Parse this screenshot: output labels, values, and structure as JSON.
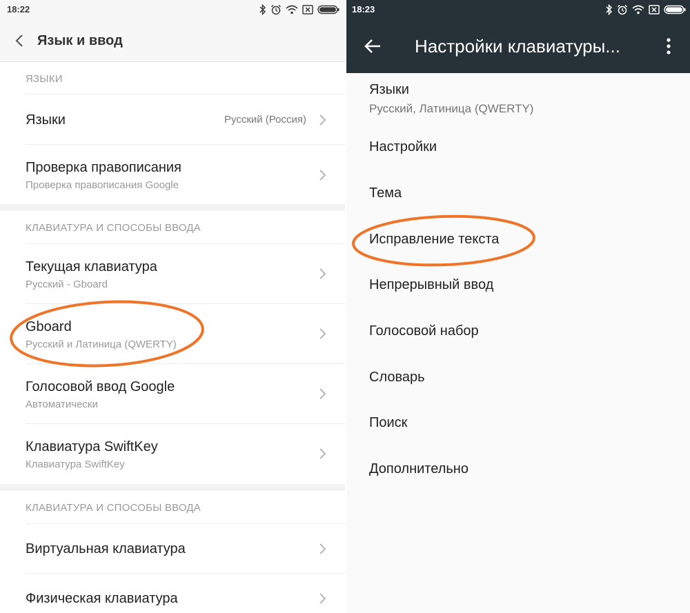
{
  "left": {
    "status_time": "18:22",
    "header_title": "Язык и ввод",
    "sections": {
      "languages": "ЯЗЫКИ",
      "keyboards": "КЛАВИАТУРА И СПОСОБЫ ВВОДА",
      "keyboards2": "КЛАВИАТУРА И СПОСОБЫ ВВОДА"
    },
    "rows": {
      "languages": {
        "title": "Языки",
        "value": "Русский (Россия)"
      },
      "spellcheck": {
        "title": "Проверка правописания",
        "subtitle": "Проверка правописания Google"
      },
      "current_keyboard": {
        "title": "Текущая клавиатура",
        "subtitle": "Русский - Gboard"
      },
      "gboard": {
        "title": "Gboard",
        "subtitle": "Русский и Латиница (QWERTY)"
      },
      "google_voice": {
        "title": "Голосовой ввод Google",
        "subtitle": "Автоматически"
      },
      "swiftkey": {
        "title": "Клавиатура SwiftKey",
        "subtitle": "Клавиатура SwiftKey"
      },
      "virtual_keyboard": {
        "title": "Виртуальная клавиатура"
      },
      "physical_keyboard": {
        "title": "Физическая клавиатура"
      }
    }
  },
  "right": {
    "status_time": "18:23",
    "toolbar_title": "Настройки клавиатуры...",
    "languages": {
      "title": "Языки",
      "subtitle": "Русский, Латиница (QWERTY)"
    },
    "items": [
      "Настройки",
      "Тема",
      "Исправление текста",
      "Непрерывный ввод",
      "Голосовой набор",
      "Словарь",
      "Поиск",
      "Дополнительно"
    ]
  },
  "colors": {
    "highlight_ellipse": "#f07427",
    "toolbar": "#263238",
    "left_background": "#ffffff",
    "right_background": "#fafafa"
  },
  "icons": [
    "bluetooth-icon",
    "alarm-icon",
    "wifi-icon",
    "sim-off-icon",
    "battery-icon",
    "back-chevron-icon",
    "chevron-right-icon",
    "back-arrow-icon",
    "more-vert-icon"
  ]
}
